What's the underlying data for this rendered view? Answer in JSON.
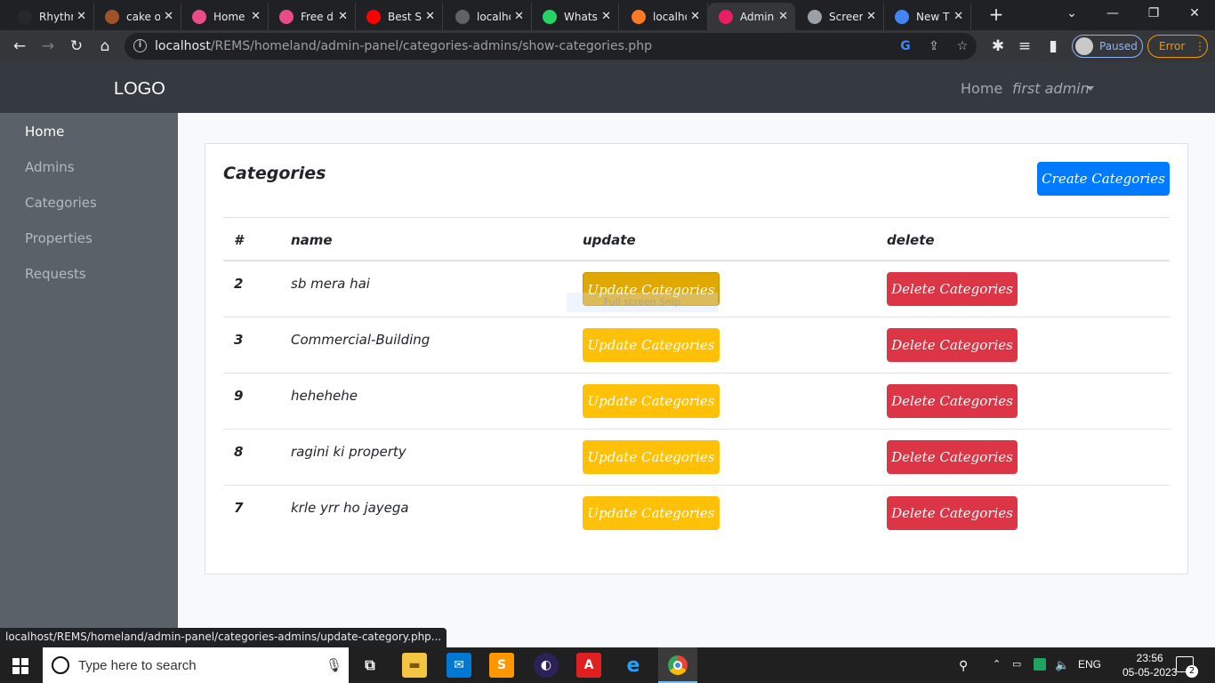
{
  "browser": {
    "tabs": [
      {
        "title": "Rhythm",
        "icon": "github-icon",
        "color": "#24292e"
      },
      {
        "title": "cake o",
        "icon": "cake-icon",
        "color": "#a0522d"
      },
      {
        "title": "Home",
        "icon": "dribbble-icon",
        "color": "#ea4c89"
      },
      {
        "title": "Free d",
        "icon": "dribbble-icon",
        "color": "#ea4c89"
      },
      {
        "title": "Best S",
        "icon": "youtube-icon",
        "color": "#ff0000"
      },
      {
        "title": "localho",
        "icon": "globe-icon",
        "color": "#5f6368"
      },
      {
        "title": "Whats",
        "icon": "whatsapp-icon",
        "color": "#25d366"
      },
      {
        "title": "localho",
        "icon": "xampp-icon",
        "color": "#fb7a24"
      },
      {
        "title": "Admin",
        "icon": "admin-icon",
        "color": "#e91e63"
      },
      {
        "title": "Screen",
        "icon": "camera-icon",
        "color": "#9aa0a6"
      },
      {
        "title": "New T",
        "icon": "chrome-icon",
        "color": "#4285f4"
      }
    ],
    "active_tab": 8,
    "url_host": "localhost",
    "url_path": "/REMS/homeland/admin-panel/categories-admins/show-categories.php",
    "profile_label": "Paused",
    "error_label": "Error",
    "status_url": "localhost/REMS/homeland/admin-panel/categories-admins/update-category.php..."
  },
  "navbar": {
    "logo": "LOGO",
    "home": "Home",
    "user": "first admin"
  },
  "sidebar": {
    "items": [
      {
        "label": "Home",
        "active": true
      },
      {
        "label": "Admins",
        "active": false
      },
      {
        "label": "Categories",
        "active": false
      },
      {
        "label": "Properties",
        "active": false
      },
      {
        "label": "Requests",
        "active": false
      }
    ]
  },
  "card": {
    "title": "Categories",
    "create_label": "Create Categories",
    "ghost_text": "Full screen Snip"
  },
  "table": {
    "headers": [
      "#",
      "name",
      "update",
      "delete"
    ],
    "update_label": "Update Categories",
    "delete_label": "Delete Categories",
    "rows": [
      {
        "id": "2",
        "name": "sb mera hai"
      },
      {
        "id": "3",
        "name": "Commercial-Building"
      },
      {
        "id": "9",
        "name": "hehehehe"
      },
      {
        "id": "8",
        "name": "ragini ki property"
      },
      {
        "id": "7",
        "name": "krle yrr ho jayega"
      }
    ]
  },
  "taskbar": {
    "search_placeholder": "Type here to search",
    "language": "ENG",
    "time": "23:56",
    "date": "05-05-2023",
    "notification_count": "2"
  },
  "colors": {
    "primary": "#007bff",
    "warning": "#ffc107",
    "danger": "#dc3545",
    "navbar": "#343a40",
    "sidebar": "#5a6169"
  }
}
